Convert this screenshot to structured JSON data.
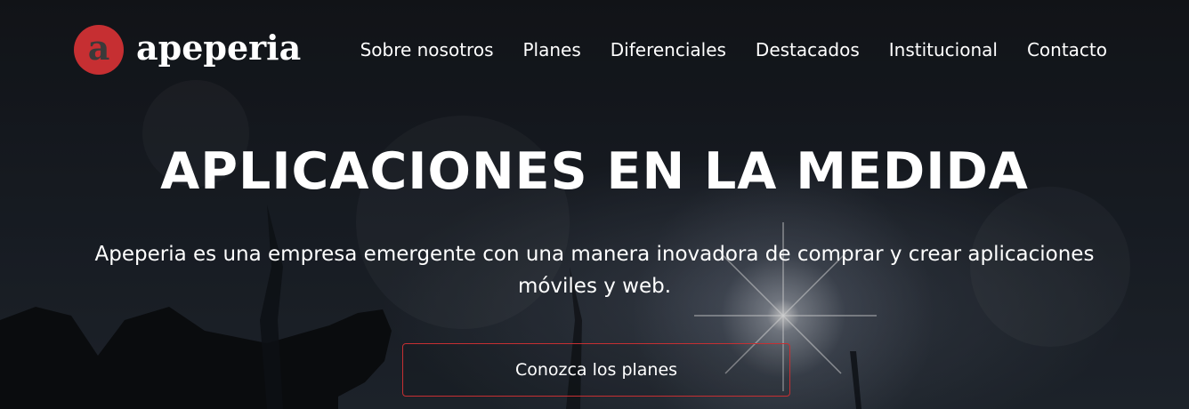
{
  "brand": {
    "badge_letter": "a",
    "name": "apeperia",
    "accent_color": "#c62f32"
  },
  "nav": {
    "items": [
      {
        "label": "Sobre nosotros"
      },
      {
        "label": "Planes"
      },
      {
        "label": "Diferenciales"
      },
      {
        "label": "Destacados"
      },
      {
        "label": "Institucional"
      },
      {
        "label": "Contacto"
      }
    ]
  },
  "hero": {
    "headline": "APLICACIONES EN LA MEDIDA",
    "description": "Apeperia es una empresa emergente con una manera inovadora de comprar y crear aplicaciones móviles y web.",
    "cta_label": "Conozca los planes"
  }
}
